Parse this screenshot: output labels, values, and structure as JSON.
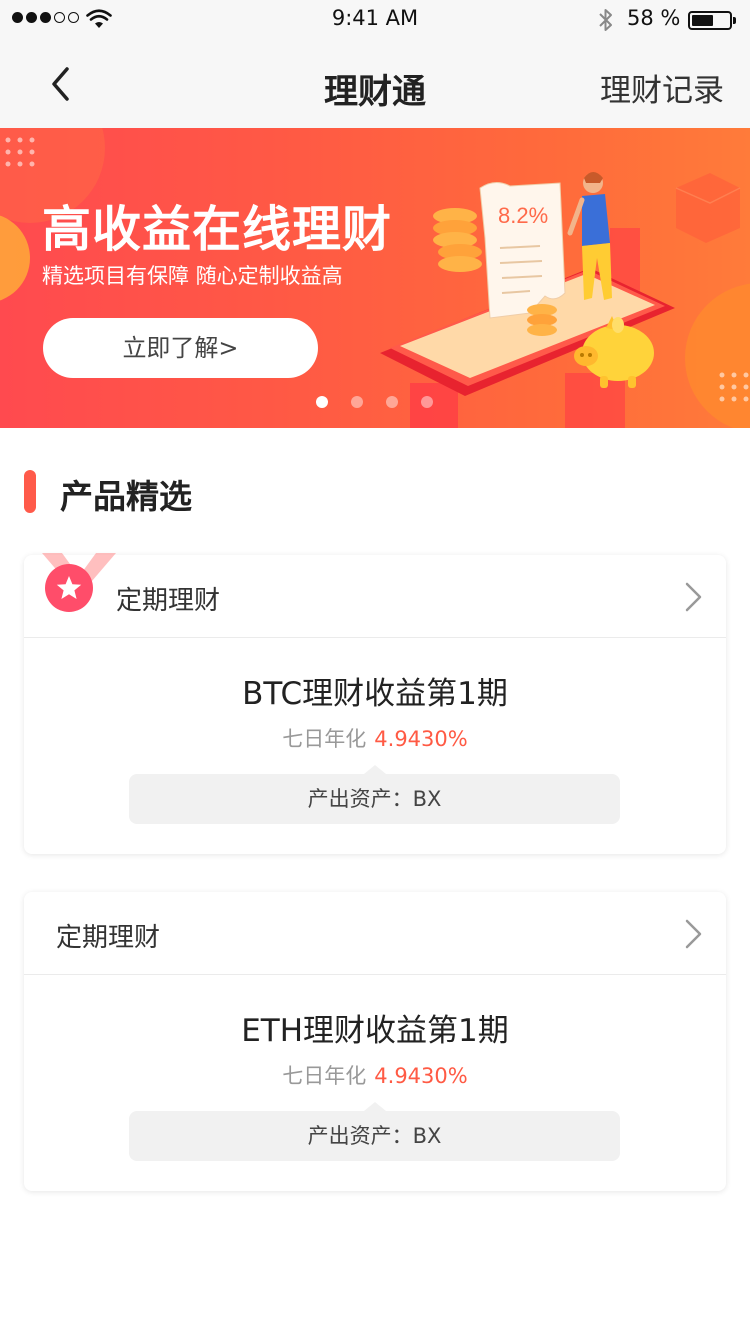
{
  "status_bar": {
    "time": "9:41 AM",
    "battery_text": "58 %",
    "battery_level": 0.58,
    "signal_bars_filled": 3,
    "signal_bars_total": 5
  },
  "nav": {
    "title": "理财通",
    "right_label": "理财记录",
    "back_icon": "chevron-left-icon"
  },
  "banner": {
    "title": "高收益在线理财",
    "subtitle": "精选项目有保障 随心定制收益高",
    "button_label": "立即了解>",
    "receipt_rate": "8.2%",
    "page_count": 4,
    "active_page": 0
  },
  "section": {
    "title": "产品精选"
  },
  "products": [
    {
      "category": "定期理财",
      "name": "BTC理财收益第1期",
      "rate_label": "七日年化",
      "rate_value": "4.9430%",
      "asset_label": "产出资产：",
      "asset_value": "BX",
      "badge": "star-medal-icon"
    },
    {
      "category": "定期理财",
      "name": "ETH理财收益第1期",
      "rate_label": "七日年化",
      "rate_value": "4.9430%",
      "asset_label": "产出资产：",
      "asset_value": "BX"
    }
  ],
  "colors": {
    "accent": "#ff5a44",
    "banner_start": "#ff4a4f",
    "banner_end": "#ff7b3a"
  }
}
